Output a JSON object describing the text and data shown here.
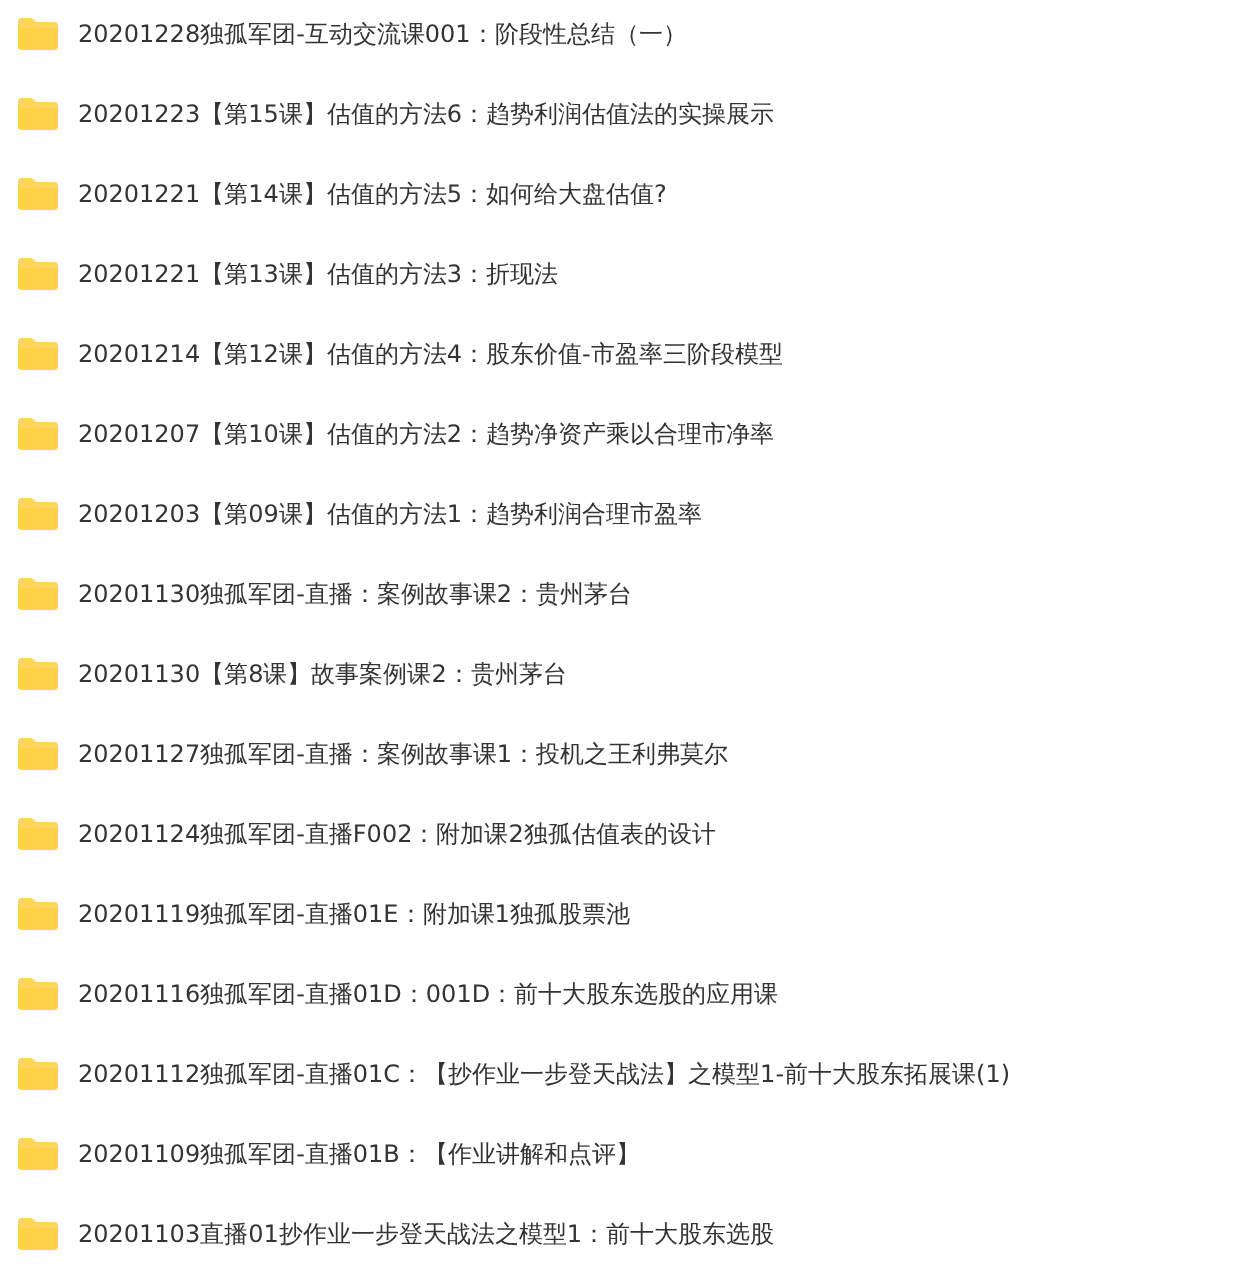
{
  "folders": [
    {
      "name": "20201228独孤军团-互动交流课001：阶段性总结（一）"
    },
    {
      "name": "20201223【第15课】估值的方法6：趋势利润估值法的实操展示"
    },
    {
      "name": "20201221【第14课】估值的方法5：如何给大盘估值?"
    },
    {
      "name": "20201221【第13课】估值的方法3：折现法"
    },
    {
      "name": "20201214【第12课】估值的方法4：股东价值-市盈率三阶段模型"
    },
    {
      "name": "20201207【第10课】估值的方法2：趋势净资产乘以合理市净率"
    },
    {
      "name": "20201203【第09课】估值的方法1：趋势利润合理市盈率"
    },
    {
      "name": "20201130独孤军团-直播：案例故事课2：贵州茅台"
    },
    {
      "name": "20201130【第8课】故事案例课2：贵州茅台"
    },
    {
      "name": "20201127独孤军团-直播：案例故事课1：投机之王利弗莫尔"
    },
    {
      "name": "20201124独孤军团-直播F002：附加课2独孤估值表的设计"
    },
    {
      "name": "20201119独孤军团-直播01E：附加课1独孤股票池"
    },
    {
      "name": "20201116独孤军团-直播01D：001D：前十大股东选股的应用课"
    },
    {
      "name": "20201112独孤军团-直播01C：【抄作业一步登天战法】之模型1-前十大股东拓展课(1)"
    },
    {
      "name": "20201109独孤军团-直播01B：【作业讲解和点评】"
    },
    {
      "name": "20201103直播01抄作业一步登天战法之模型1：前十大股东选股"
    }
  ]
}
